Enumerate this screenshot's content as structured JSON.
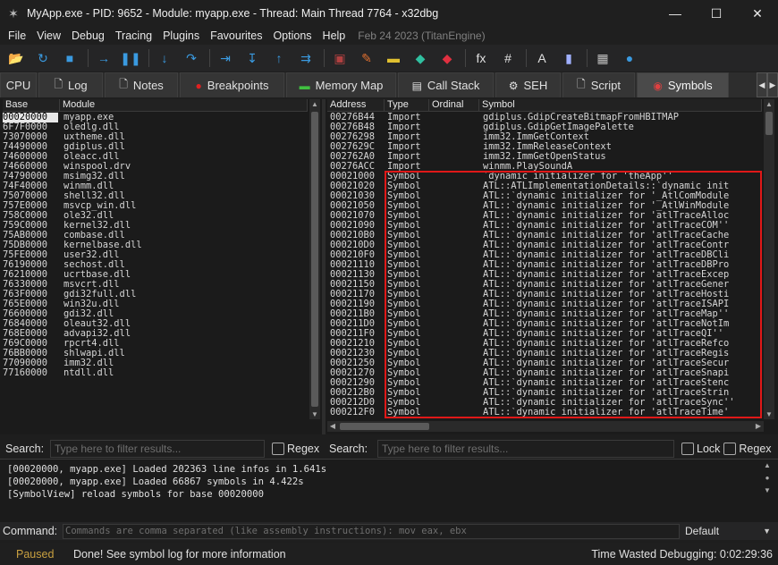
{
  "window": {
    "title": "MyApp.exe - PID: 9652 - Module: myapp.exe - Thread: Main Thread 7764 - x32dbg",
    "minimize_glyph": "—",
    "maximize_glyph": "☐",
    "close_glyph": "✕"
  },
  "menu": {
    "items": [
      "File",
      "View",
      "Debug",
      "Tracing",
      "Plugins",
      "Favourites",
      "Options",
      "Help"
    ],
    "build_info": "Feb 24 2023 (TitanEngine)"
  },
  "toolbar": {
    "icons": [
      {
        "name": "open-icon",
        "glyph": "📂",
        "color": "#e0a030"
      },
      {
        "name": "restart-icon",
        "glyph": "↻",
        "color": "#3a9ae0"
      },
      {
        "name": "stop-icon",
        "glyph": "■",
        "color": "#3a9ae0"
      },
      {
        "name": "run-icon",
        "glyph": "→",
        "color": "#3a9ae0"
      },
      {
        "name": "pause-icon",
        "glyph": "❚❚",
        "color": "#3a9ae0"
      },
      {
        "name": "step-into-icon",
        "glyph": "↓",
        "color": "#3a9ae0"
      },
      {
        "name": "step-over-icon",
        "glyph": "↷",
        "color": "#3a9ae0"
      },
      {
        "name": "trace-into-icon",
        "glyph": "⇥",
        "color": "#3a9ae0"
      },
      {
        "name": "trace-over-icon",
        "glyph": "↧",
        "color": "#3a9ae0"
      },
      {
        "name": "execute-till-return-icon",
        "glyph": "↑",
        "color": "#3a9ae0"
      },
      {
        "name": "run-to-user-code-icon",
        "glyph": "⇉",
        "color": "#3a9ae0"
      },
      {
        "name": "scylla-icon",
        "glyph": "▣",
        "color": "#b04040"
      },
      {
        "name": "patch-icon",
        "glyph": "✎",
        "color": "#e07030"
      },
      {
        "name": "comment-icon",
        "glyph": "▬",
        "color": "#e0c030"
      },
      {
        "name": "label-icon",
        "glyph": "◆",
        "color": "#30c0a0"
      },
      {
        "name": "bookmark-icon",
        "glyph": "◆",
        "color": "#e03040"
      },
      {
        "name": "function-icon",
        "glyph": "fx",
        "color": "#e0e0e0"
      },
      {
        "name": "hash-icon",
        "glyph": "#",
        "color": "#e0e0e0"
      },
      {
        "name": "font-icon",
        "glyph": "A",
        "color": "#e0e0e0"
      },
      {
        "name": "device-icon",
        "glyph": "▮",
        "color": "#a0b0ff"
      },
      {
        "name": "calculator-icon",
        "glyph": "▦",
        "color": "#c0c0c0"
      },
      {
        "name": "globe-icon",
        "glyph": "●",
        "color": "#3a9ae0"
      }
    ]
  },
  "tabs": [
    {
      "label": "CPU",
      "icon": "",
      "icon_name": "cpu-icon",
      "width": 41
    },
    {
      "label": "Log",
      "icon": "🗋",
      "icon_name": "log-icon",
      "width": 72
    },
    {
      "label": "Notes",
      "icon": "🗋",
      "icon_name": "notes-icon",
      "width": 82
    },
    {
      "label": "Breakpoints",
      "icon": "●",
      "icon_name": "breakpoints-icon",
      "width": 117
    },
    {
      "label": "Memory Map",
      "icon": "▬",
      "icon_name": "memory-map-icon",
      "width": 123
    },
    {
      "label": "Call Stack",
      "icon": "▤",
      "icon_name": "call-stack-icon",
      "width": 107
    },
    {
      "label": "SEH",
      "icon": "⚙",
      "icon_name": "seh-icon",
      "width": 73
    },
    {
      "label": "Script",
      "icon": "🗋",
      "icon_name": "script-icon",
      "width": 81
    },
    {
      "label": "Symbols",
      "icon": "◉",
      "icon_name": "symbols-icon",
      "width": 103,
      "active": true
    }
  ],
  "modules": {
    "headers": {
      "base": "Base",
      "module": "Module"
    },
    "rows": [
      {
        "base": "00020000",
        "module": "myapp.exe",
        "selected": true
      },
      {
        "base": "6F7F0000",
        "module": "oledlg.dll"
      },
      {
        "base": "73070000",
        "module": "uxtheme.dll"
      },
      {
        "base": "74490000",
        "module": "gdiplus.dll"
      },
      {
        "base": "74600000",
        "module": "oleacc.dll"
      },
      {
        "base": "74660000",
        "module": "winspool.drv"
      },
      {
        "base": "74790000",
        "module": "msimg32.dll"
      },
      {
        "base": "74F40000",
        "module": "winmm.dll"
      },
      {
        "base": "75070000",
        "module": "shell32.dll"
      },
      {
        "base": "757E0000",
        "module": "msvcp_win.dll"
      },
      {
        "base": "758C0000",
        "module": "ole32.dll"
      },
      {
        "base": "759C0000",
        "module": "kernel32.dll"
      },
      {
        "base": "75AB0000",
        "module": "combase.dll"
      },
      {
        "base": "75DB0000",
        "module": "kernelbase.dll"
      },
      {
        "base": "75FE0000",
        "module": "user32.dll"
      },
      {
        "base": "76190000",
        "module": "sechost.dll"
      },
      {
        "base": "76210000",
        "module": "ucrtbase.dll"
      },
      {
        "base": "76330000",
        "module": "msvcrt.dll"
      },
      {
        "base": "763F0000",
        "module": "gdi32full.dll"
      },
      {
        "base": "765E0000",
        "module": "win32u.dll"
      },
      {
        "base": "76600000",
        "module": "gdi32.dll"
      },
      {
        "base": "76840000",
        "module": "oleaut32.dll"
      },
      {
        "base": "768E0000",
        "module": "advapi32.dll"
      },
      {
        "base": "769C0000",
        "module": "rpcrt4.dll"
      },
      {
        "base": "76BB0000",
        "module": "shlwapi.dll"
      },
      {
        "base": "77090000",
        "module": "imm32.dll"
      },
      {
        "base": "77160000",
        "module": "ntdll.dll"
      }
    ]
  },
  "symbols": {
    "headers": {
      "address": "Address",
      "type": "Type",
      "ordinal": "Ordinal",
      "symbol": "Symbol"
    },
    "rows": [
      {
        "address": "00276B44",
        "type": "Import",
        "ordinal": "",
        "symbol": "gdiplus.GdipCreateBitmapFromHBITMAP"
      },
      {
        "address": "00276B48",
        "type": "Import",
        "ordinal": "",
        "symbol": "gdiplus.GdipGetImagePalette"
      },
      {
        "address": "00276298",
        "type": "Import",
        "ordinal": "",
        "symbol": "imm32.ImmGetContext"
      },
      {
        "address": "0027629C",
        "type": "Import",
        "ordinal": "",
        "symbol": "imm32.ImmReleaseContext"
      },
      {
        "address": "002762A0",
        "type": "Import",
        "ordinal": "",
        "symbol": "imm32.ImmGetOpenStatus"
      },
      {
        "address": "00276ACC",
        "type": "Import",
        "ordinal": "",
        "symbol": "winmm.PlaySoundA"
      },
      {
        "address": "00021000",
        "type": "Symbol",
        "ordinal": "",
        "symbol": "`dynamic initializer for 'theApp''"
      },
      {
        "address": "00021020",
        "type": "Symbol",
        "ordinal": "",
        "symbol": "ATL::ATLImplementationDetails::`dynamic init"
      },
      {
        "address": "00021030",
        "type": "Symbol",
        "ordinal": "",
        "symbol": "ATL::`dynamic initializer for '_AtlComModule"
      },
      {
        "address": "00021050",
        "type": "Symbol",
        "ordinal": "",
        "symbol": "ATL::`dynamic initializer for '_AtlWinModule"
      },
      {
        "address": "00021070",
        "type": "Symbol",
        "ordinal": "",
        "symbol": "ATL::`dynamic initializer for 'atlTraceAlloc"
      },
      {
        "address": "00021090",
        "type": "Symbol",
        "ordinal": "",
        "symbol": "ATL::`dynamic initializer for 'atlTraceCOM''"
      },
      {
        "address": "000210B0",
        "type": "Symbol",
        "ordinal": "",
        "symbol": "ATL::`dynamic initializer for 'atlTraceCache"
      },
      {
        "address": "000210D0",
        "type": "Symbol",
        "ordinal": "",
        "symbol": "ATL::`dynamic initializer for 'atlTraceContr"
      },
      {
        "address": "000210F0",
        "type": "Symbol",
        "ordinal": "",
        "symbol": "ATL::`dynamic initializer for 'atlTraceDBCli"
      },
      {
        "address": "00021110",
        "type": "Symbol",
        "ordinal": "",
        "symbol": "ATL::`dynamic initializer for 'atlTraceDBPro"
      },
      {
        "address": "00021130",
        "type": "Symbol",
        "ordinal": "",
        "symbol": "ATL::`dynamic initializer for 'atlTraceExcep"
      },
      {
        "address": "00021150",
        "type": "Symbol",
        "ordinal": "",
        "symbol": "ATL::`dynamic initializer for 'atlTraceGener"
      },
      {
        "address": "00021170",
        "type": "Symbol",
        "ordinal": "",
        "symbol": "ATL::`dynamic initializer for 'atlTraceHosti"
      },
      {
        "address": "00021190",
        "type": "Symbol",
        "ordinal": "",
        "symbol": "ATL::`dynamic initializer for 'atlTraceISAPI"
      },
      {
        "address": "000211B0",
        "type": "Symbol",
        "ordinal": "",
        "symbol": "ATL::`dynamic initializer for 'atlTraceMap''"
      },
      {
        "address": "000211D0",
        "type": "Symbol",
        "ordinal": "",
        "symbol": "ATL::`dynamic initializer for 'atlTraceNotIm"
      },
      {
        "address": "000211F0",
        "type": "Symbol",
        "ordinal": "",
        "symbol": "ATL::`dynamic initializer for 'atlTraceQI''"
      },
      {
        "address": "00021210",
        "type": "Symbol",
        "ordinal": "",
        "symbol": "ATL::`dynamic initializer for 'atlTraceRefco"
      },
      {
        "address": "00021230",
        "type": "Symbol",
        "ordinal": "",
        "symbol": "ATL::`dynamic initializer for 'atlTraceRegis"
      },
      {
        "address": "00021250",
        "type": "Symbol",
        "ordinal": "",
        "symbol": "ATL::`dynamic initializer for 'atlTraceSecur"
      },
      {
        "address": "00021270",
        "type": "Symbol",
        "ordinal": "",
        "symbol": "ATL::`dynamic initializer for 'atlTraceSnapi"
      },
      {
        "address": "00021290",
        "type": "Symbol",
        "ordinal": "",
        "symbol": "ATL::`dynamic initializer for 'atlTraceStenc"
      },
      {
        "address": "000212B0",
        "type": "Symbol",
        "ordinal": "",
        "symbol": "ATL::`dynamic initializer for 'atlTraceStrin"
      },
      {
        "address": "000212D0",
        "type": "Symbol",
        "ordinal": "",
        "symbol": "ATL::`dynamic initializer for 'atlTraceSync''"
      },
      {
        "address": "000212F0",
        "type": "Symbol",
        "ordinal": "",
        "symbol": "ATL::`dynamic initializer for 'atlTraceTime'"
      }
    ],
    "highlight_color": "#e01818"
  },
  "search": {
    "label": "Search:",
    "placeholder": "Type here to filter results...",
    "regex_label": "Regex",
    "lock_label": "Lock"
  },
  "log": {
    "lines": [
      "[00020000, myapp.exe] Loaded 202363 line infos in 1.641s",
      "[00020000, myapp.exe] Loaded 66867 symbols in 4.422s",
      "[SymbolView] reload symbols for base 00020000"
    ]
  },
  "command": {
    "label": "Command:",
    "placeholder": "Commands are comma separated (like assembly instructions): mov eax, ebx",
    "mode": "Default"
  },
  "status": {
    "state": "Paused",
    "message": "Done! See symbol log for more information",
    "time_wasted": "Time Wasted Debugging: 0:02:29:36"
  },
  "colors": {
    "accent_paused": "#c8a040",
    "selection_bg": "#e8e8e8"
  }
}
